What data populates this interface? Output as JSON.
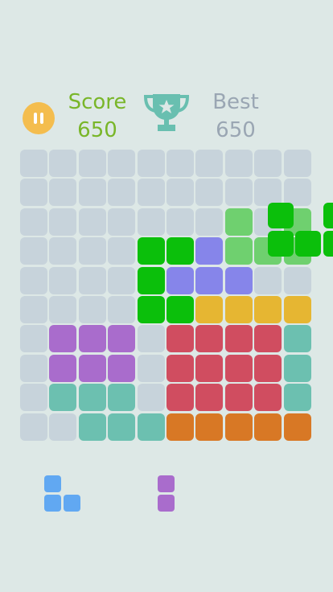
{
  "header": {
    "score_label": "Score",
    "score_value": "650",
    "best_label": "Best",
    "best_value": "650"
  },
  "icons": {
    "pause": "pause-icon",
    "trophy": "trophy-icon"
  },
  "colors": {
    "background": "#dde8e6",
    "empty": "#c7d3db",
    "green": "#0bbf0b",
    "green_preview": "#6fd06f",
    "purple": "#a96ccc",
    "indigo": "#8685ea",
    "red": "#d04d60",
    "yellow": "#e6b632",
    "teal": "#6cc0b0",
    "orange": "#d87825",
    "blue": "#61a8f2",
    "score": "#79b629",
    "best": "#9aa6b3",
    "pause": "#f4bd4e",
    "trophy": "#69bfb0"
  },
  "board": {
    "rows": [
      [
        "",
        "",
        "",
        "",
        "",
        "",
        "",
        "",
        "",
        ""
      ],
      [
        "",
        "",
        "",
        "",
        "",
        "",
        "",
        "",
        "",
        ""
      ],
      [
        "",
        "",
        "",
        "",
        "",
        "",
        "",
        "",
        "",
        ""
      ],
      [
        "",
        "",
        "",
        "",
        "green",
        "green",
        "indigo",
        "",
        "",
        ""
      ],
      [
        "",
        "",
        "",
        "",
        "green",
        "indigo",
        "indigo",
        "indigo",
        "",
        ""
      ],
      [
        "",
        "",
        "",
        "",
        "green",
        "green",
        "yellow",
        "yellow",
        "yellow",
        "yellow"
      ],
      [
        "",
        "purple",
        "purple",
        "purple",
        "",
        "red",
        "red",
        "red",
        "red",
        "teal"
      ],
      [
        "",
        "purple",
        "purple",
        "purple",
        "",
        "red",
        "red",
        "red",
        "red",
        "teal"
      ],
      [
        "",
        "teal",
        "teal",
        "teal",
        "",
        "red",
        "red",
        "red",
        "red",
        "teal"
      ],
      [
        "",
        "",
        "teal",
        "teal",
        "teal",
        "orange",
        "orange",
        "orange",
        "orange",
        "orange"
      ]
    ],
    "preview_cells": [
      [
        2,
        7
      ],
      [
        2,
        9
      ],
      [
        3,
        7
      ],
      [
        3,
        8
      ],
      [
        3,
        9
      ]
    ],
    "dragged_piece": [
      [
        0,
        1
      ],
      [
        0,
        3
      ],
      [
        1,
        1
      ],
      [
        1,
        2
      ],
      [
        1,
        3
      ]
    ]
  },
  "tray": {
    "piece1": [
      [
        0,
        0
      ],
      [
        1,
        0
      ],
      [
        1,
        1
      ]
    ],
    "piece2": [
      [
        0,
        0
      ],
      [
        1,
        0
      ]
    ]
  }
}
